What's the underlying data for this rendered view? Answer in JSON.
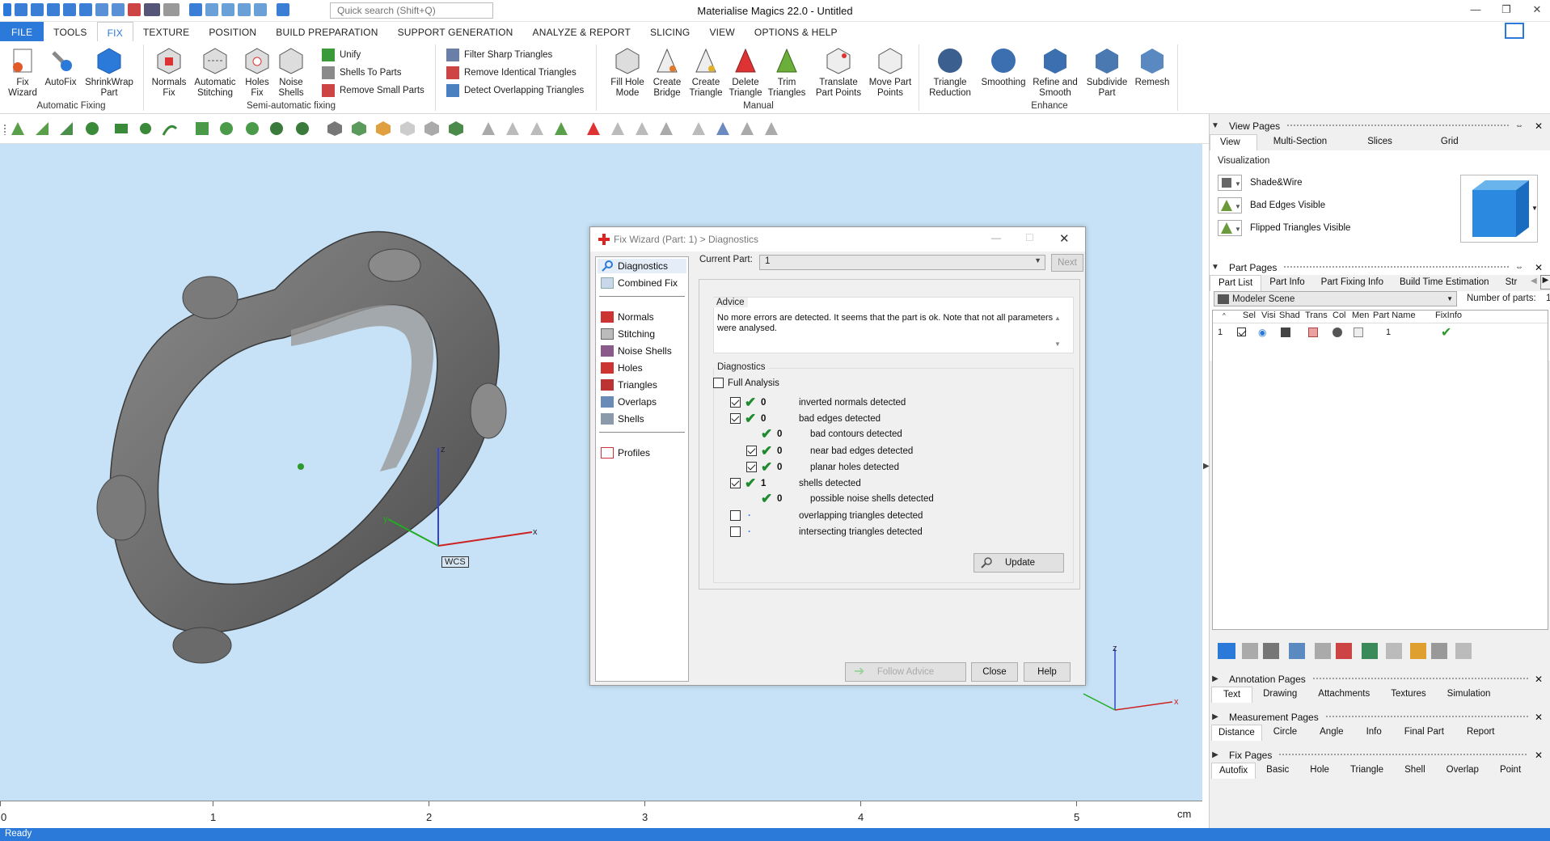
{
  "window": {
    "title": "Materialise Magics 22.0 - Untitled",
    "search_placeholder": "Quick search (Shift+Q)"
  },
  "menu": {
    "tabs": [
      "FILE",
      "TOOLS",
      "FIX",
      "TEXTURE",
      "POSITION",
      "BUILD PREPARATION",
      "SUPPORT GENERATION",
      "ANALYZE & REPORT",
      "SLICING",
      "VIEW",
      "OPTIONS & HELP"
    ],
    "active": "FIX"
  },
  "ribbon": {
    "fix_wizard": "Fix Wizard",
    "autofix": "AutoFix",
    "shrinkwrap": "ShrinkWrap Part",
    "group_auto": "Automatic Fixing",
    "normals_fix": "Normals Fix",
    "auto_stitching": "Automatic Stitching",
    "holes_fix": "Holes Fix",
    "noise_shells": "Noise Shells",
    "unify": "Unify",
    "shells_to_parts": "Shells To Parts",
    "remove_small_parts": "Remove Small Parts",
    "group_semi": "Semi-automatic fixing",
    "filter_sharp": "Filter Sharp Triangles",
    "remove_identical": "Remove Identical Triangles",
    "detect_overlapping": "Detect Overlapping Triangles",
    "fill_hole_mode": "Fill Hole Mode",
    "create_bridge": "Create Bridge",
    "create_triangle": "Create Triangle",
    "delete_triangle": "Delete Triangle",
    "trim_triangles": "Trim Triangles",
    "translate_points": "Translate Part Points",
    "move_points": "Move Part Points",
    "group_manual": "Manual",
    "triangle_reduction": "Triangle Reduction",
    "smoothing": "Smoothing",
    "refine_smooth": "Refine and Smooth",
    "subdivide": "Subdivide Part",
    "remesh": "Remesh",
    "group_enhance": "Enhance"
  },
  "viewport": {
    "wcs_label": "WCS",
    "axis_z": "z",
    "axis_y": "y",
    "axis_x": "x"
  },
  "ruler": {
    "labels": [
      "0",
      "1",
      "2",
      "3",
      "4",
      "5"
    ],
    "unit": "cm"
  },
  "status": "Ready",
  "dialog": {
    "title": "Fix Wizard (Part: 1) > Diagnostics",
    "nav": [
      "Diagnostics",
      "Combined Fix",
      "Normals",
      "Stitching",
      "Noise Shells",
      "Holes",
      "Triangles",
      "Overlaps",
      "Shells",
      "Profiles"
    ],
    "current_part_label": "Current Part:",
    "current_part_value": "1",
    "next": "Next",
    "advice_title": "Advice",
    "advice_text": "No more errors are detected. It seems that the part is ok. Note that not all parameters were analysed.",
    "diag_title": "Diagnostics",
    "full_analysis": "Full Analysis",
    "rows": [
      {
        "count": "0",
        "label": "inverted normals detected"
      },
      {
        "count": "0",
        "label": "bad edges detected"
      },
      {
        "count": "0",
        "label": "bad contours detected"
      },
      {
        "count": "0",
        "label": "near bad edges detected"
      },
      {
        "count": "0",
        "label": "planar holes detected"
      },
      {
        "count": "1",
        "label": "shells detected"
      },
      {
        "count": "0",
        "label": "possible noise shells detected"
      },
      {
        "count": "",
        "label": "overlapping triangles detected"
      },
      {
        "count": "",
        "label": "intersecting triangles detected"
      }
    ],
    "update": "Update",
    "follow_advice": "Follow Advice",
    "close": "Close",
    "help": "Help"
  },
  "panel": {
    "view_pages": "View Pages",
    "view_tabs": [
      "View",
      "Multi-Section",
      "Slices",
      "Grid"
    ],
    "visualization": "Visualization",
    "vis_items": [
      "Shade&Wire",
      "Bad Edges Visible",
      "Flipped Triangles Visible"
    ],
    "part_pages": "Part Pages",
    "part_tabs": [
      "Part List",
      "Part Info",
      "Part Fixing Info",
      "Build Time Estimation",
      "Str"
    ],
    "scene": "Modeler Scene",
    "num_parts_label": "Number of parts:",
    "num_parts": "1",
    "cols": [
      "Sel",
      "Visi",
      "Shad",
      "Trans",
      "Col",
      "Men",
      "Part Name",
      "FixInfo"
    ],
    "row": {
      "idx": "1",
      "name": "1"
    },
    "annotation_pages": "Annotation Pages",
    "annotation_tabs": [
      "Text",
      "Drawing",
      "Attachments",
      "Textures",
      "Simulation"
    ],
    "measurement_pages": "Measurement Pages",
    "measurement_tabs": [
      "Distance",
      "Circle",
      "Angle",
      "Info",
      "Final Part",
      "Report"
    ],
    "fix_pages": "Fix Pages",
    "fix_tabs": [
      "Autofix",
      "Basic",
      "Hole",
      "Triangle",
      "Shell",
      "Overlap",
      "Point"
    ]
  }
}
